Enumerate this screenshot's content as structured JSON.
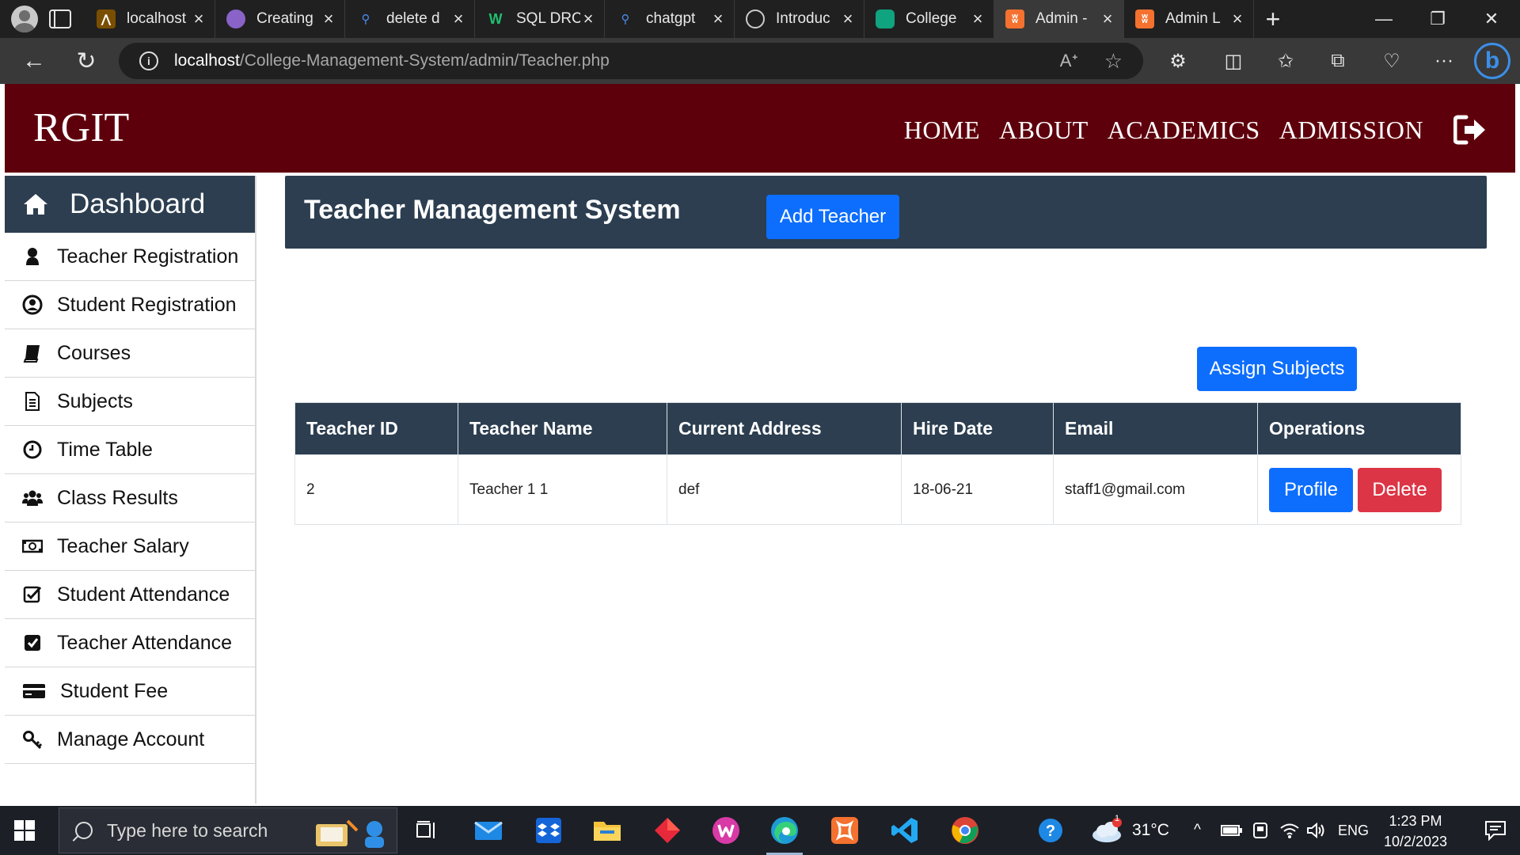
{
  "browser": {
    "tabs": [
      {
        "title": "localhost",
        "color": "#7a4e00"
      },
      {
        "title": "Creating",
        "color": "#8a63c9"
      },
      {
        "title": "delete d",
        "color": "#3b6fd8"
      },
      {
        "title": "SQL DRC",
        "color": "#1d8a55"
      },
      {
        "title": "chatgpt",
        "color": "#3b6fd8"
      },
      {
        "title": "Introduc",
        "color": "#4a4a4a"
      },
      {
        "title": "College",
        "color": "#10a37f"
      },
      {
        "title": "Admin -",
        "color": "#f4712f"
      },
      {
        "title": "Admin L",
        "color": "#f4712f"
      }
    ],
    "active_tab_index": 7,
    "url_host": "localhost",
    "url_path": "/College-Management-System/admin/Teacher.php"
  },
  "site": {
    "brand": "RGIT",
    "menu": [
      "HOME",
      "ABOUT",
      "ACADEMICS",
      "ADMISSION"
    ]
  },
  "sidebar": {
    "dashboard_label": "Dashboard",
    "items": [
      {
        "label": "Teacher Registration",
        "icon": "user-icon"
      },
      {
        "label": "Student Registration",
        "icon": "user-circle-icon"
      },
      {
        "label": "Courses",
        "icon": "book-icon"
      },
      {
        "label": "Subjects",
        "icon": "document-icon"
      },
      {
        "label": "Time Table",
        "icon": "clock-icon"
      },
      {
        "label": "Class Results",
        "icon": "users-icon"
      },
      {
        "label": "Teacher Salary",
        "icon": "money-icon"
      },
      {
        "label": "Student Attendance",
        "icon": "check-square-icon"
      },
      {
        "label": "Teacher Attendance",
        "icon": "check-square-filled-icon"
      },
      {
        "label": "Student Fee",
        "icon": "credit-card-icon"
      },
      {
        "label": "Manage Account",
        "icon": "key-icon"
      }
    ]
  },
  "main": {
    "title": "Teacher Management System",
    "add_button": "Add Teacher",
    "assign_button": "Assign Subjects",
    "table": {
      "headers": [
        "Teacher ID",
        "Teacher Name",
        "Current Address",
        "Hire Date",
        "Email",
        "Operations"
      ],
      "rows": [
        {
          "id": "2",
          "name": "Teacher 1 1",
          "address": "def",
          "hire_date": "18-06-21",
          "email": "staff1@gmail.com",
          "profile_label": "Profile",
          "delete_label": "Delete"
        }
      ]
    }
  },
  "taskbar": {
    "search_placeholder": "Type here to search",
    "weather_temp": "31°C",
    "weather_badge": "1",
    "language": "ENG",
    "time": "1:23 PM",
    "date": "10/2/2023"
  },
  "colors": {
    "nav_bg": "#5e000c",
    "panel_bg": "#2c3e50",
    "primary": "#0d6efd",
    "danger": "#dc3545"
  }
}
